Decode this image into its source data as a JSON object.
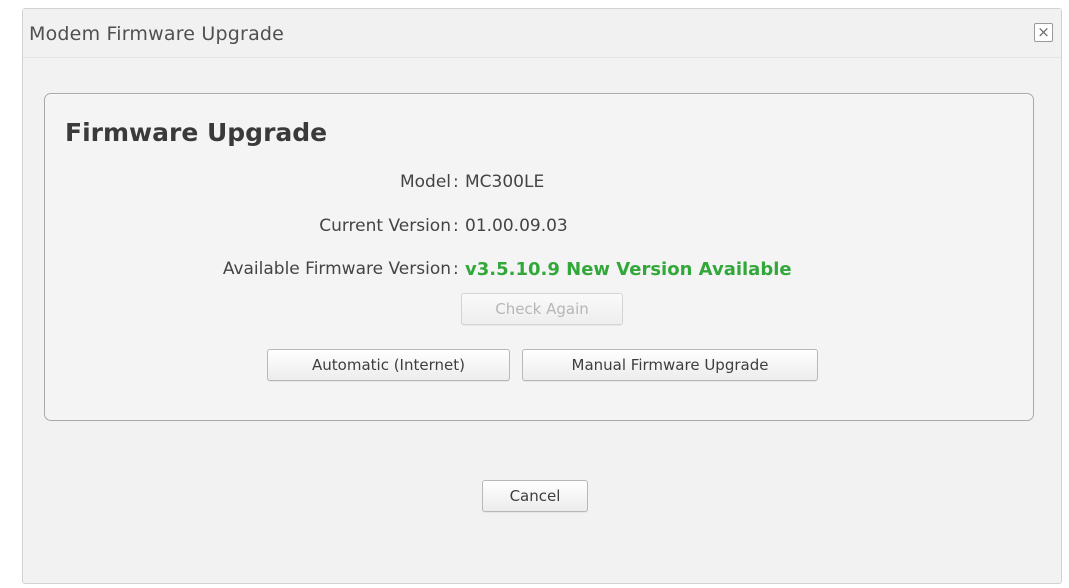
{
  "dialog": {
    "title": "Modem Firmware Upgrade",
    "close_label": "×"
  },
  "panel": {
    "title": "Firmware Upgrade",
    "rows": [
      {
        "label": "Model",
        "value": "MC300LE"
      },
      {
        "label": "Current Version",
        "value": "01.00.09.03"
      },
      {
        "label": "Available Firmware Version",
        "value": "v3.5.10.9 New Version Available"
      }
    ],
    "check_again_label": "Check Again",
    "automatic_label": "Automatic (Internet)",
    "manual_label": "Manual Firmware Upgrade"
  },
  "footer": {
    "cancel_label": "Cancel"
  },
  "colors": {
    "available_version": "#33a83a"
  }
}
